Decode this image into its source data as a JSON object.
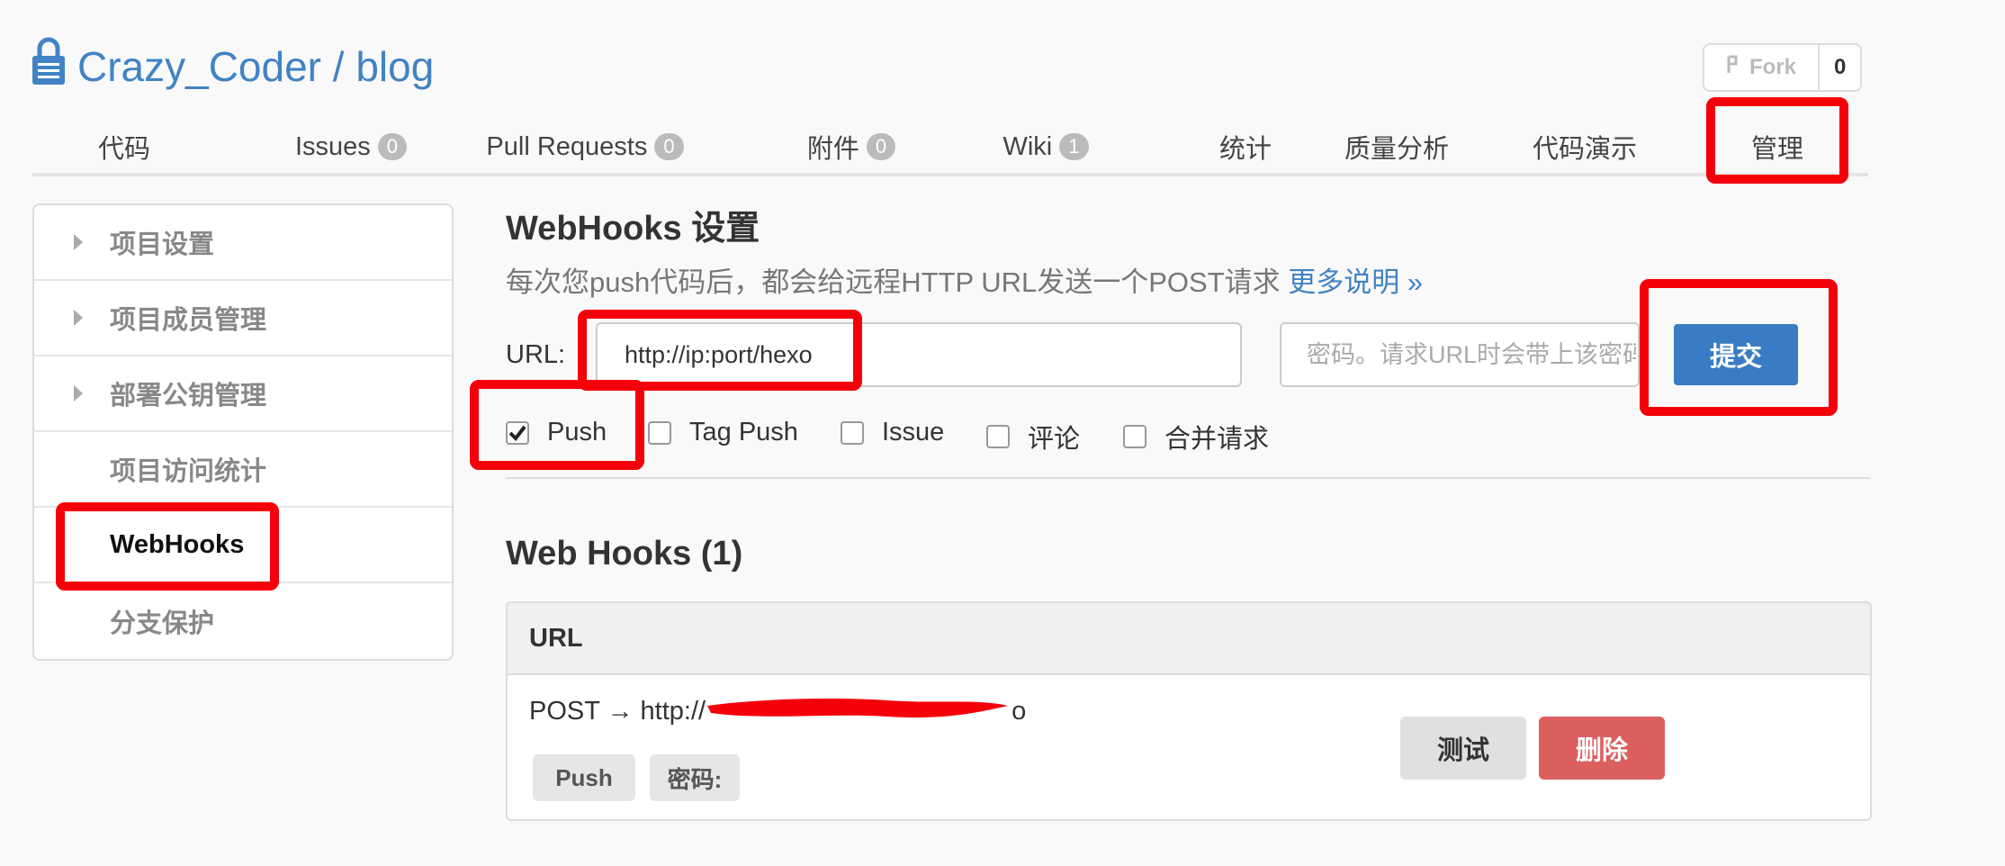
{
  "repo": {
    "owner": "Crazy_Coder",
    "separator": " / ",
    "name": "blog"
  },
  "fork": {
    "label": "Fork",
    "count": "0"
  },
  "tabs": [
    {
      "label": "代码",
      "badge": null
    },
    {
      "label": "Issues",
      "badge": "0"
    },
    {
      "label": "Pull Requests",
      "badge": "0"
    },
    {
      "label": "附件",
      "badge": "0"
    },
    {
      "label": "Wiki",
      "badge": "1"
    },
    {
      "label": "统计",
      "badge": null
    },
    {
      "label": "质量分析",
      "badge": null
    },
    {
      "label": "代码演示",
      "badge": null
    },
    {
      "label": "管理",
      "badge": null
    }
  ],
  "sidebar": {
    "items": [
      {
        "label": "项目设置",
        "has_caret": true
      },
      {
        "label": "项目成员管理",
        "has_caret": true
      },
      {
        "label": "部署公钥管理",
        "has_caret": true
      },
      {
        "label": "项目访问统计",
        "has_caret": false
      },
      {
        "label": "WebHooks",
        "has_caret": false,
        "active": true
      },
      {
        "label": "分支保护",
        "has_caret": false
      }
    ]
  },
  "webhooks": {
    "title": "WebHooks 设置",
    "description": "每次您push代码后，都会给远程HTTP URL发送一个POST请求 ",
    "more_link": "更多说明 »",
    "url_label": "URL:",
    "url_value": "http://ip:port/hexo",
    "password_placeholder": "密码。请求URL时会带上该密码",
    "submit_label": "提交",
    "events": [
      {
        "label": "Push",
        "checked": true
      },
      {
        "label": "Tag Push",
        "checked": false
      },
      {
        "label": "Issue",
        "checked": false
      },
      {
        "label": "评论",
        "checked": false
      },
      {
        "label": "合并请求",
        "checked": false
      }
    ]
  },
  "hook_list": {
    "title": "Web Hooks (1)",
    "column_header": "URL",
    "rows": [
      {
        "method_url": "POST → http://",
        "url_end": "o",
        "tags": [
          "Push",
          "密码:"
        ],
        "test_label": "测试",
        "delete_label": "删除"
      }
    ]
  },
  "colors": {
    "link": "#4183c4",
    "primary_button": "#3a7cc4",
    "danger_button": "#dc5f5f",
    "annotation": "#f4000b"
  }
}
